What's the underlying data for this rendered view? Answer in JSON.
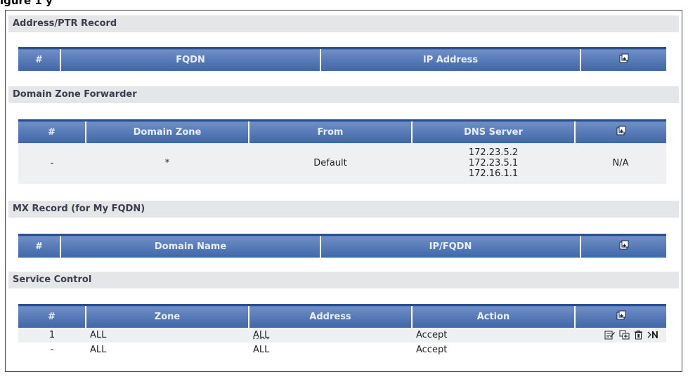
{
  "figure_title": "igure 1 y",
  "sections": {
    "address_ptr": {
      "title": "Address/PTR Record",
      "columns": [
        "#",
        "FQDN",
        "IP Address"
      ]
    },
    "zone_forwarder": {
      "title": "Domain Zone Forwarder",
      "columns": [
        "#",
        "Domain Zone",
        "From",
        "DNS Server"
      ],
      "rows": [
        {
          "num": "-",
          "zone": "*",
          "from": "Default",
          "dns1": "172.23.5.2",
          "dns2": "172.23.5.1",
          "dns3": "172.16.1.1",
          "action": "N/A"
        }
      ]
    },
    "mx_record": {
      "title": "MX Record (for My FQDN)",
      "columns": [
        "#",
        "Domain Name",
        "IP/FQDN"
      ]
    },
    "service_control": {
      "title": "Service Control",
      "columns": [
        "#",
        "Zone",
        "Address",
        "Action"
      ],
      "rows": [
        {
          "num": "1",
          "zone": "ALL",
          "address": "ALL",
          "action": "Accept"
        },
        {
          "num": "-",
          "zone": "ALL",
          "address": "ALL",
          "action": "Accept"
        }
      ]
    }
  },
  "icons": {
    "add": "add-entry-icon",
    "edit": "edit-icon",
    "insert": "insert-icon",
    "delete": "delete-icon",
    "move": "move-icon"
  }
}
